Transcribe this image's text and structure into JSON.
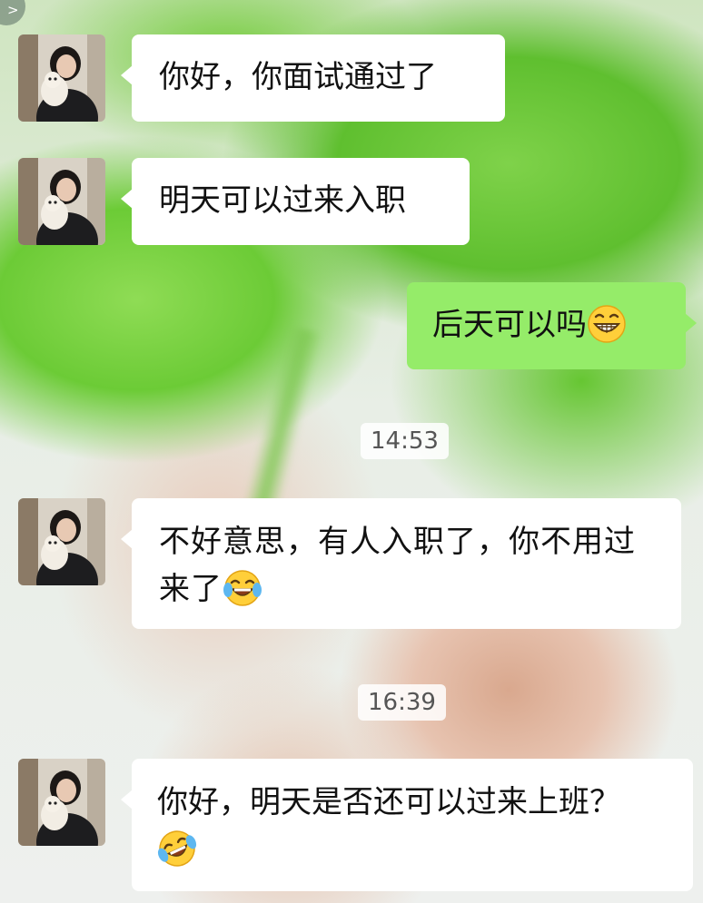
{
  "chat": {
    "messages": [
      {
        "sender": "contact",
        "text": "你好，你面试通过了"
      },
      {
        "sender": "contact",
        "text": "明天可以过来入职"
      },
      {
        "sender": "me",
        "text": "后天可以吗",
        "emoji": "grin-emoji"
      },
      {
        "sender": "contact",
        "text": "不好意思，有人入职了，你不用过来了",
        "emoji": "laughing-tears-emoji"
      },
      {
        "sender": "contact",
        "text": "你好，明天是否还可以过来上班？",
        "emoji": "rolling-laughing-emoji"
      }
    ],
    "timestamps": [
      "14:53",
      "16:39"
    ]
  },
  "colors": {
    "incoming_bubble": "#ffffff",
    "outgoing_bubble": "#95ec69"
  },
  "icons": {
    "back": "chevron-right-icon",
    "avatar": "contact-avatar-photo"
  }
}
